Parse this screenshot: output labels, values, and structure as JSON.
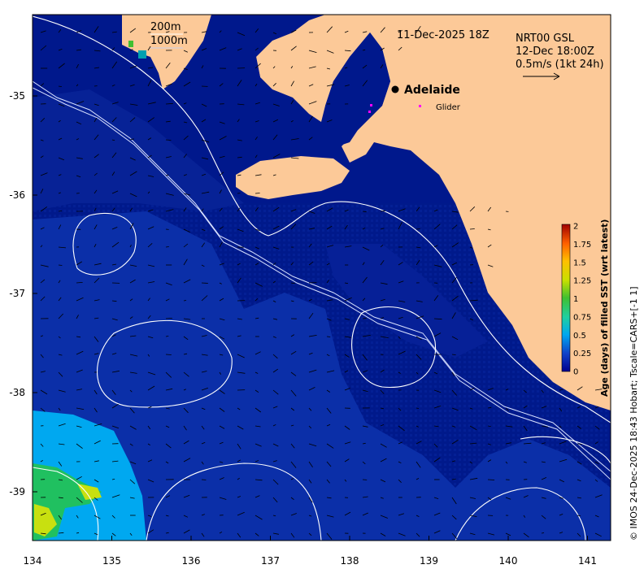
{
  "map": {
    "date_label": "11-Dec-2025 18Z",
    "model_label": "NRT00 GSL",
    "model_time": "12-Dec 18:00Z",
    "scale_label": "0.5m/s (1kt 24h)",
    "bathy_200": "200m",
    "bathy_1000": "1000m",
    "city": "Adelaide",
    "glider_label": "Glider",
    "colorbar_title": "Age (days) of filled SST (wrt latest)",
    "colorbar_ticks": [
      "2",
      "1.75",
      "1.5",
      "1.25",
      "1",
      "0.75",
      "0.5",
      "0.25",
      "0"
    ],
    "credit": "© IMOS 24-Dec-2025 18:43 Hobart; Tscale=CARS+[-1 1]",
    "x_ticks": [
      "134",
      "135",
      "136",
      "137",
      "138",
      "139",
      "140",
      "141"
    ],
    "y_ticks": [
      "-35",
      "-36",
      "-37",
      "-38",
      "-39"
    ],
    "colors": {
      "land": "#fcc998",
      "sea_dark": "#00188c",
      "sea_mid": "#0b2fa8",
      "sea_light": "#00a8f0",
      "glider": "#ff00ff"
    }
  }
}
